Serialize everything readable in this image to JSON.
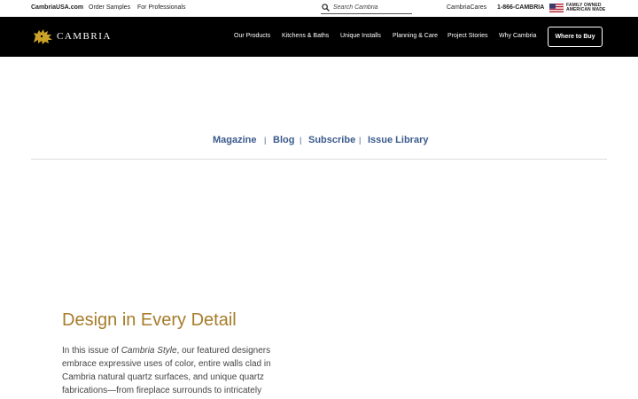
{
  "utility_bar": {
    "home_link": "CambriaUSA.com",
    "order_samples": "Order Samples",
    "for_professionals": "For Professionals",
    "search_placeholder": "Search Cambria",
    "cambria_cares": "CambriaCares",
    "phone": "1-866-CAMBRIA",
    "family_owned_line1": "FAMILY OWNED",
    "family_owned_line2": "AMERICAN MADE"
  },
  "main_nav": {
    "logo_text": "CAMBRIA",
    "items": [
      {
        "label": "Our Products"
      },
      {
        "label": "Kitchens & Baths"
      },
      {
        "label": "Unique Installs"
      },
      {
        "label": "Planning & Care"
      },
      {
        "label": "Project Stories"
      },
      {
        "label": "Why Cambria"
      }
    ],
    "where_to_buy": "Where to Buy"
  },
  "sub_nav": {
    "items": [
      {
        "label": "Magazine"
      },
      {
        "label": "Blog"
      },
      {
        "label": "Subscribe"
      },
      {
        "label": "Issue Library"
      }
    ],
    "separator": "|"
  },
  "hero": {
    "title": "Design in Every Detail",
    "body_prefix": "In this issue of ",
    "body_italic": "Cambria Style",
    "body_suffix": ", our featured designers embrace expressive uses of color, entire walls clad in Cambria natural quartz surfaces, and unique quartz fabrications—from fireplace surrounds to intricately"
  },
  "colors": {
    "nav_background": "#000000",
    "accent_gold": "#a67c2a",
    "link_blue": "#3a5a8c",
    "logo_gold": "#c9a227"
  }
}
